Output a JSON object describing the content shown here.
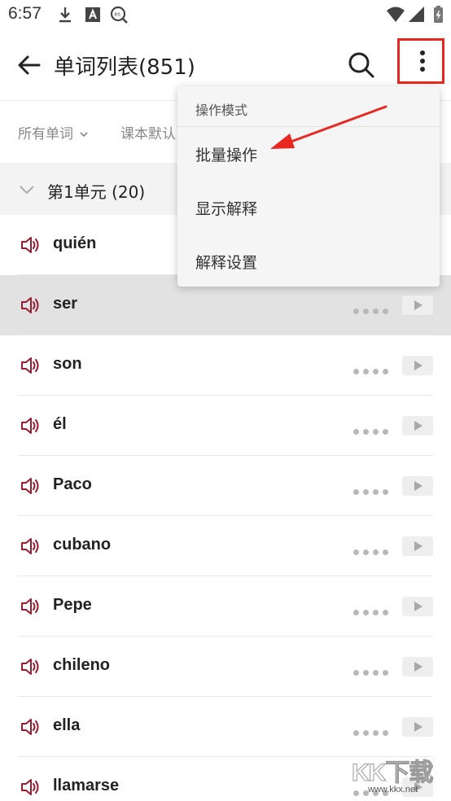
{
  "status_bar": {
    "time": "6:57",
    "left_icons": [
      "download-icon",
      "font-a-icon",
      "es-dictionary-icon"
    ],
    "right_icons": [
      "wifi-icon",
      "signal-icon",
      "battery-charging-icon"
    ]
  },
  "app_bar": {
    "back_icon": "arrow-left-icon",
    "title": "单词列表(851)",
    "search_icon": "search-icon",
    "more_icon": "more-vertical-icon"
  },
  "filters": {
    "all_words": "所有单词",
    "textbook_default": "课本默认"
  },
  "section": {
    "title": "第1单元 (20)"
  },
  "words": [
    {
      "text": "quién",
      "highlight": false
    },
    {
      "text": "ser",
      "highlight": true
    },
    {
      "text": "son",
      "highlight": false
    },
    {
      "text": "él",
      "highlight": false
    },
    {
      "text": "Paco",
      "highlight": false
    },
    {
      "text": "cubano",
      "highlight": false
    },
    {
      "text": "Pepe",
      "highlight": false
    },
    {
      "text": "chileno",
      "highlight": false
    },
    {
      "text": "ella",
      "highlight": false
    },
    {
      "text": "llamarse",
      "highlight": false
    }
  ],
  "menu": {
    "header": "操作模式",
    "items": [
      {
        "label": "批量操作"
      },
      {
        "label": "显示解释"
      },
      {
        "label": "解释设置"
      }
    ]
  },
  "watermark": {
    "logo": "KK下载",
    "url": "www.kkx.net"
  },
  "colors": {
    "accent_red": "#e8281f",
    "speaker_red": "#9b1b2e",
    "section_bg": "#f3f3f3",
    "highlight_row": "#e2e2e2"
  }
}
